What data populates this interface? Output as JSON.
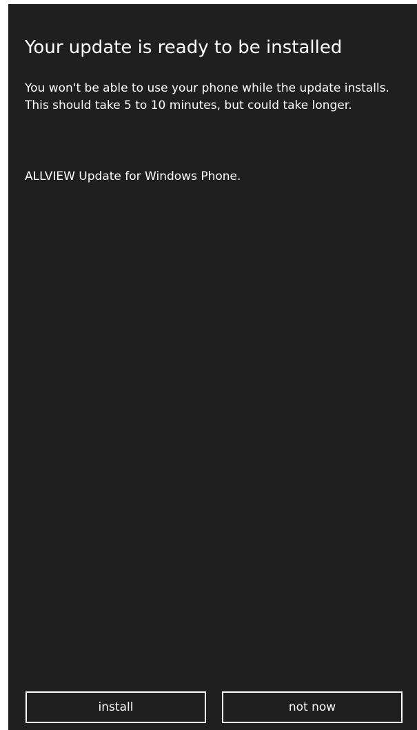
{
  "dialog": {
    "title": "Your update is ready to be installed",
    "description": "You won't be able to use your phone while the update installs. This should take 5 to 10 minutes, but could take longer.",
    "update_name": "ALLVIEW Update for Windows Phone."
  },
  "actions": {
    "install_label": "install",
    "not_now_label": "not now"
  },
  "colors": {
    "background": "#1f1f1f",
    "foreground": "#ffffff"
  }
}
